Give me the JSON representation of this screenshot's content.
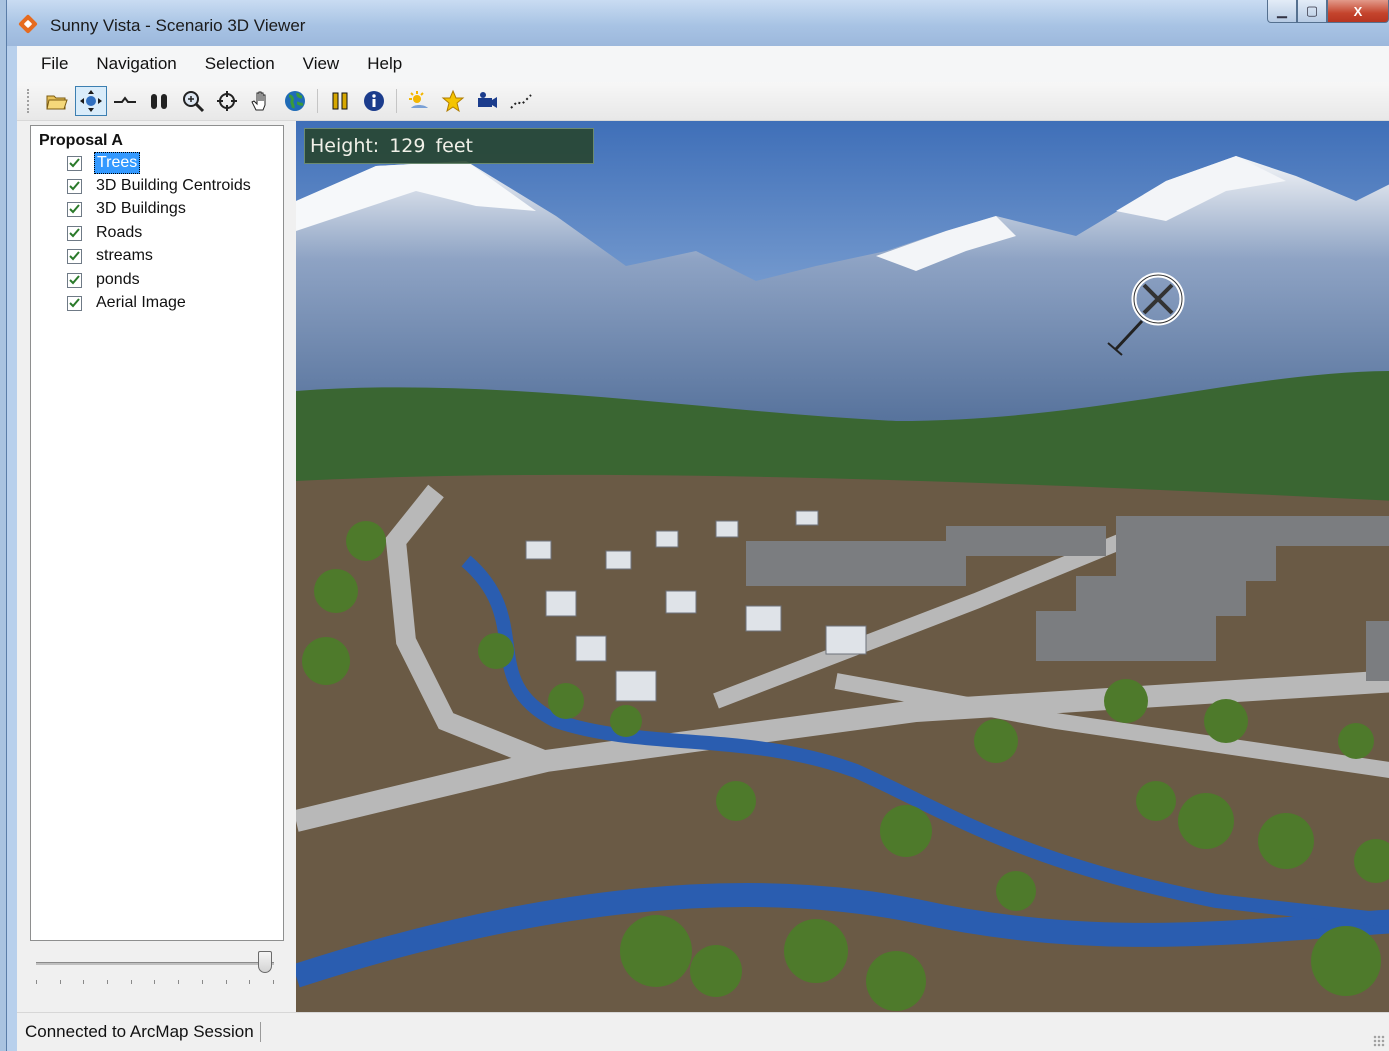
{
  "window": {
    "title": "Sunny Vista - Scenario 3D Viewer",
    "controls": {
      "minimize": "▁",
      "maximize": "▢",
      "close": "X"
    }
  },
  "menu": [
    "File",
    "Navigation",
    "Selection",
    "View",
    "Help"
  ],
  "toolbar": {
    "buttons": [
      "open-folder-icon",
      "navigate-icon",
      "fly-icon",
      "zoom-in-out-icon",
      "zoom-window-icon",
      "center-target-icon",
      "pan-hand-icon",
      "full-extent-globe-icon",
      "pause-icon",
      "info-icon",
      "sun-position-icon",
      "bookmark-star-icon",
      "camera-icon",
      "animation-path-icon"
    ]
  },
  "toc": {
    "root": "Proposal A",
    "layers": [
      {
        "label": "Trees",
        "checked": true,
        "selected": true
      },
      {
        "label": "3D Building Centroids",
        "checked": true,
        "selected": false
      },
      {
        "label": "3D Buildings",
        "checked": true,
        "selected": false
      },
      {
        "label": "Roads",
        "checked": true,
        "selected": false
      },
      {
        "label": "streams",
        "checked": true,
        "selected": false
      },
      {
        "label": "ponds",
        "checked": true,
        "selected": false
      },
      {
        "label": "Aerial Image",
        "checked": true,
        "selected": false
      }
    ]
  },
  "viewport": {
    "height_label": "Height:",
    "height_value": "129",
    "height_unit": "feet"
  },
  "status": {
    "text": "Connected to ArcMap Session"
  },
  "colors": {
    "selection": "#3399ff",
    "stream": "#2a5db0",
    "road": "#b8b8b8",
    "ground": "#6a5a45",
    "forest": "#3e6b35"
  }
}
